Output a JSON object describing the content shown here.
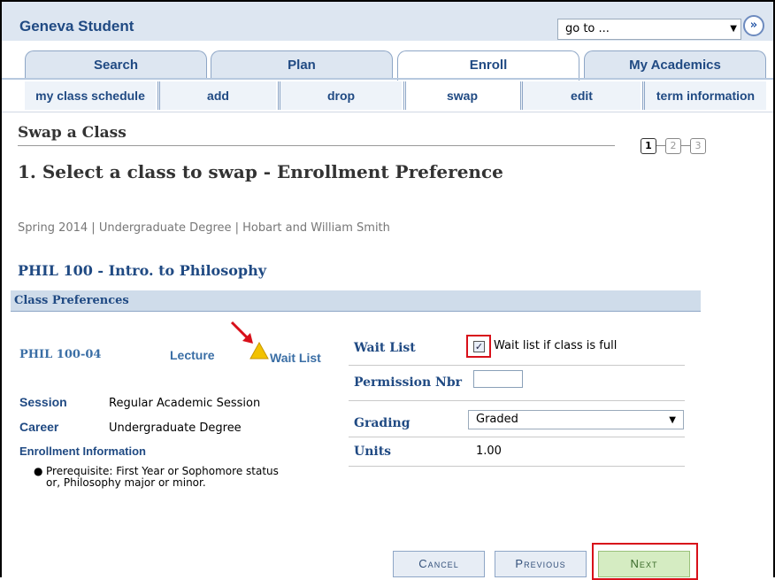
{
  "header": {
    "app_title": "Geneva Student",
    "goto_value": "go to ...",
    "goto_button_glyph": "»"
  },
  "tabs": [
    {
      "label": "Search"
    },
    {
      "label": "Plan"
    },
    {
      "label": "Enroll",
      "active": true
    },
    {
      "label": "My Academics"
    }
  ],
  "subnav": [
    {
      "label": "my class schedule"
    },
    {
      "label": "add"
    },
    {
      "label": "drop"
    },
    {
      "label": "swap",
      "active": true
    },
    {
      "label": "edit"
    },
    {
      "label": "term information"
    }
  ],
  "page": {
    "title": "Swap a Class",
    "step_heading": "1.  Select a class to swap - Enrollment Preference",
    "steps": [
      "1",
      "2",
      "3"
    ],
    "current_step": 1,
    "term_info": "Spring 2014 | Undergraduate Degree | Hobart and William Smith",
    "class_title": "PHIL  100 - Intro. to Philosophy"
  },
  "preferences": {
    "section_title": "Class Preferences",
    "class_code": "PHIL  100-04",
    "class_type": "Lecture",
    "status": "Wait List",
    "session_label": "Session",
    "session_value": "Regular Academic Session",
    "career_label": "Career",
    "career_value": "Undergraduate Degree",
    "enrollment_info_label": "Enrollment Information",
    "prerequisite": "Prerequisite: First Year or Sophomore status or, Philosophy major or minor."
  },
  "form": {
    "waitlist_label": "Wait List",
    "waitlist_checked": true,
    "waitlist_text": "Wait list if class is full",
    "permission_label": "Permission Nbr",
    "permission_value": "",
    "grading_label": "Grading",
    "grading_value": "Graded",
    "units_label": "Units",
    "units_value": "1.00"
  },
  "buttons": {
    "cancel": "Cancel",
    "previous": "Previous",
    "next": "Next"
  },
  "colors": {
    "brand_blue": "#204a83",
    "link_blue": "#3a6ea5",
    "highlight_red": "#d8101a",
    "warning_yellow": "#f2c200",
    "next_green": "#d5ecc2"
  }
}
